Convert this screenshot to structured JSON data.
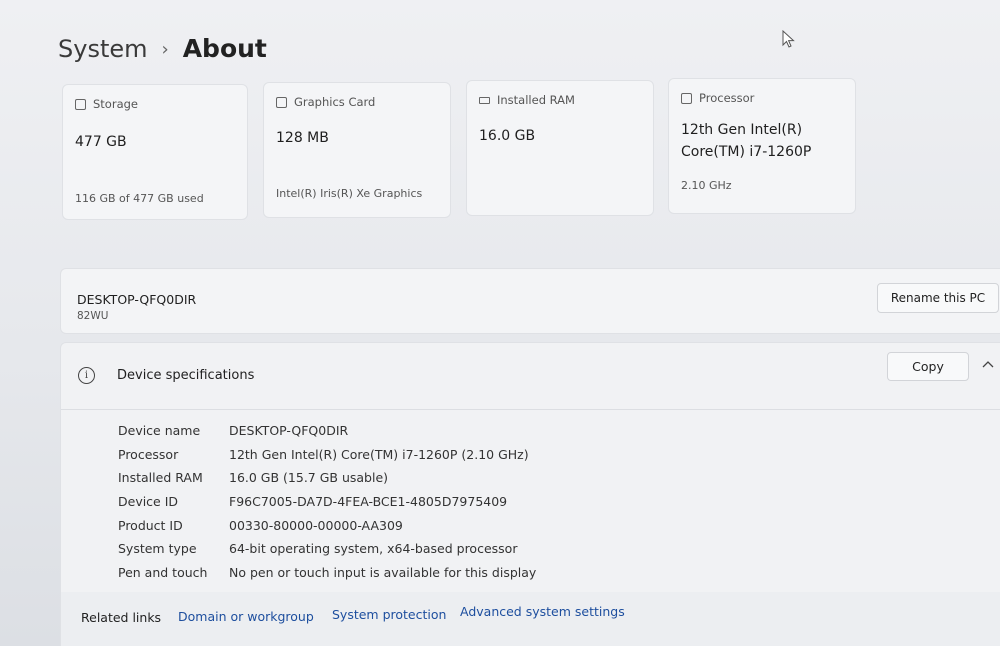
{
  "breadcrumb": {
    "parent": "System",
    "separator": "›",
    "current": "About"
  },
  "cards": {
    "storage": {
      "title": "Storage",
      "value": "477 GB",
      "sub": "116 GB of 477 GB used",
      "icon": "storage-icon"
    },
    "graphics": {
      "title": "Graphics Card",
      "value": "128 MB",
      "sub": "Intel(R) Iris(R) Xe Graphics",
      "icon": "graphics-card-icon"
    },
    "ram": {
      "title": "Installed RAM",
      "value": "16.0 GB",
      "sub": "",
      "icon": "ram-icon"
    },
    "processor": {
      "title": "Processor",
      "value_line1": "12th Gen Intel(R)",
      "value_line2": "Core(TM) i7-1260P",
      "sub": "2.10 GHz",
      "icon": "processor-icon"
    }
  },
  "device": {
    "name": "DESKTOP-QFQ0DIR",
    "model": "82WU",
    "rename_label": "Rename this PC"
  },
  "specs": {
    "title": "Device specifications",
    "copy_label": "Copy",
    "rows": [
      {
        "label": "Device name",
        "value": "DESKTOP-QFQ0DIR"
      },
      {
        "label": "Processor",
        "value": "12th Gen Intel(R) Core(TM) i7-1260P (2.10 GHz)"
      },
      {
        "label": "Installed RAM",
        "value": "16.0 GB (15.7 GB usable)"
      },
      {
        "label": "Device ID",
        "value": "F96C7005-DA7D-4FEA-BCE1-4805D7975409"
      },
      {
        "label": "Product ID",
        "value": "00330-80000-00000-AA309"
      },
      {
        "label": "System type",
        "value": "64-bit operating system, x64-based processor"
      },
      {
        "label": "Pen and touch",
        "value": "No pen or touch input is available for this display"
      }
    ]
  },
  "related": {
    "label": "Related links",
    "links": [
      "Domain or workgroup",
      "System protection",
      "Advanced system settings"
    ]
  },
  "colors": {
    "link": "#1d4e9e",
    "card_bg": "#f4f5f7",
    "page_bg": "#e9ebee"
  }
}
